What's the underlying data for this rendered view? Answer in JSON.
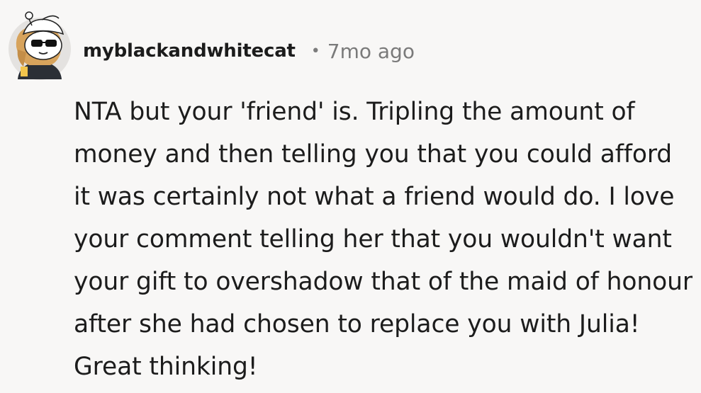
{
  "comment": {
    "author": {
      "username": "myblackandwhitecat",
      "avatar_icon": "snoo-avatar-sunglasses-icon"
    },
    "separator": "•",
    "timestamp": "7mo ago",
    "body": "NTA but your 'friend' is. Tripling the amount of money and then telling you that you could afford it was certainly not what a friend would do. I love your comment telling her that you wouldn't want your gift to overshadow that of the maid of honour after she had chosen to replace you with Julia! Great thinking!"
  },
  "colors": {
    "background": "#f8f7f6",
    "text": "#1c1c1c",
    "meta": "#7a7a7a"
  }
}
